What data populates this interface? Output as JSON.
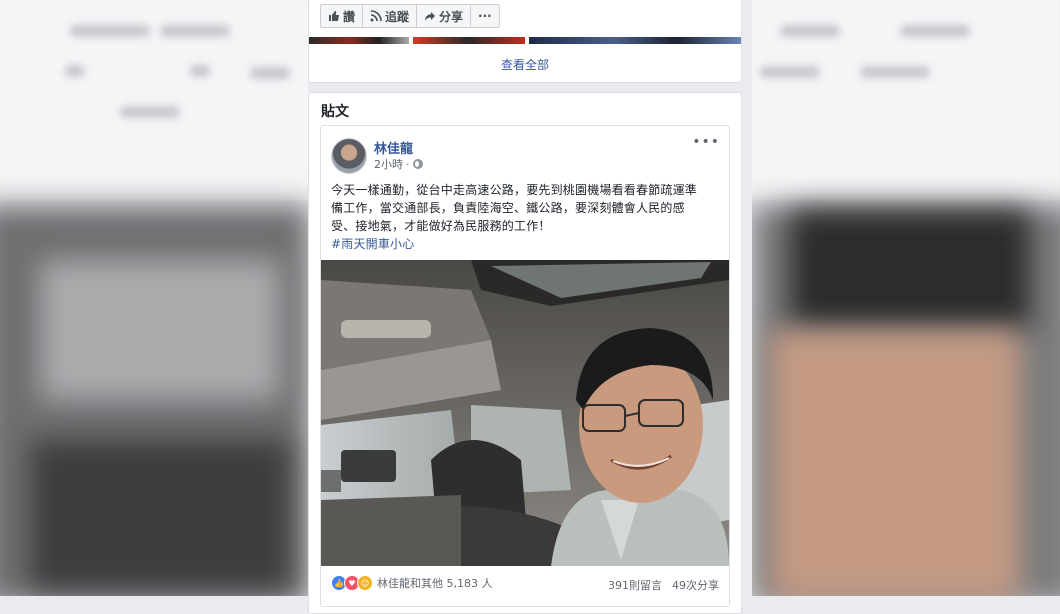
{
  "page_actions": {
    "like_label": "讚",
    "follow_label": "追蹤",
    "share_label": "分享",
    "more_label": "···"
  },
  "see_all": "查看全部",
  "posts_section": {
    "title": "貼文"
  },
  "post": {
    "author": "林佳龍",
    "time": "2小時",
    "privacy_icon": "globe-icon",
    "options": "•••",
    "text_line_1": "今天一樣通勤，從台中走高速公路，要先到桃園機場看看春節疏運準",
    "text_line_2": "備工作，當交通部長，負責陸海空、鐵公路，要深刻體會人民的感",
    "text_line_3": "受、接地氣，才能做好為民服務的工作！",
    "hashtag": "#雨天開車小心",
    "reactions_text": "林佳龍和其他 5,183 人",
    "comments": "391則留言",
    "shares": "49次分享"
  },
  "colors": {
    "link_blue": "#365899",
    "like_blue": "#4080ff",
    "love_red": "#f25268",
    "haha_yellow": "#f7b125",
    "page_bg": "#e9ebee"
  }
}
